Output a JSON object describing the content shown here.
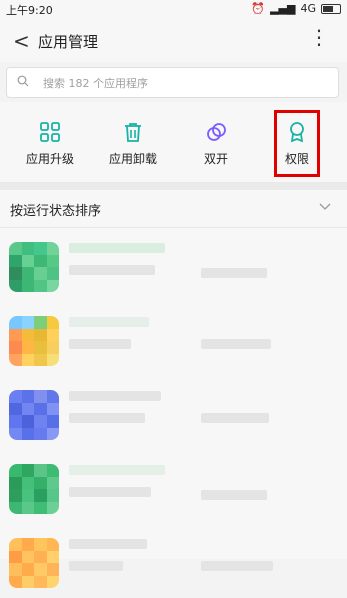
{
  "status_bar": {
    "time": "上午9:20",
    "network": "4G"
  },
  "app_bar": {
    "title": "应用管理",
    "back_glyph": "<",
    "more_glyph": "⋮"
  },
  "search": {
    "placeholder": "搜索 182 个应用程序"
  },
  "tools": [
    {
      "label": "应用升级",
      "icon": "grid-icon"
    },
    {
      "label": "应用卸载",
      "icon": "trash-icon"
    },
    {
      "label": "双开",
      "icon": "dual-circle-icon"
    },
    {
      "label": "权限",
      "icon": "badge-icon"
    }
  ],
  "sort": {
    "label": "按运行状态排序"
  },
  "colors": {
    "accent": "#18b3a5",
    "purple": "#7a5cff",
    "highlight": "#e00000"
  }
}
